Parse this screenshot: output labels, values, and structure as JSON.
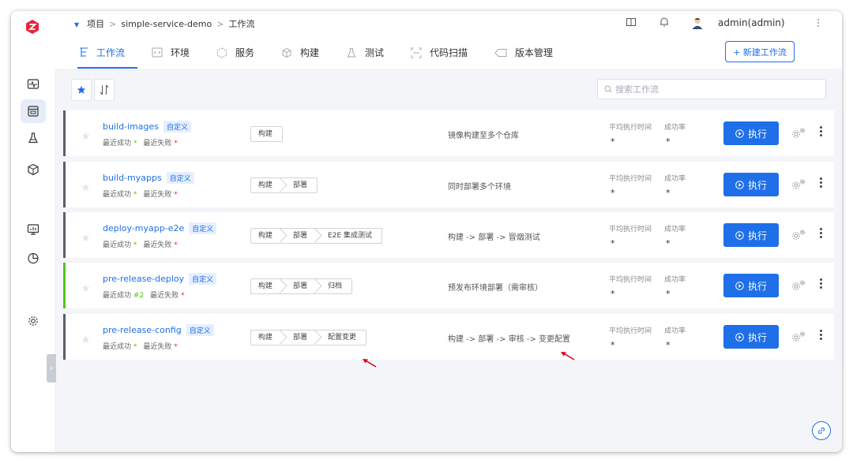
{
  "colors": {
    "accent": "#1e6fe8",
    "success": "#52c41a",
    "danger": "#f5222d"
  },
  "breadcrumb": {
    "root": "项目",
    "project": "simple-service-demo",
    "current": "工作流",
    "sep": ">"
  },
  "user": {
    "name": "admin(admin)"
  },
  "rail_icons": [
    "monitor-pulse-icon",
    "workflow-icon",
    "flask-icon",
    "package-icon",
    "dashboard-icon",
    "pie-chart-icon",
    "gear-icon"
  ],
  "tabs": [
    {
      "label": "工作流",
      "icon": "workflow-icon",
      "active": true
    },
    {
      "label": "环境",
      "icon": "code-icon"
    },
    {
      "label": "服务",
      "icon": "hexagon-icon"
    },
    {
      "label": "构建",
      "icon": "box-icon"
    },
    {
      "label": "测试",
      "icon": "flask-icon"
    },
    {
      "label": "代码扫描",
      "icon": "scan-icon"
    },
    {
      "label": "版本管理",
      "icon": "tag-icon"
    }
  ],
  "new_button": "+ 新建工作流",
  "search": {
    "placeholder": "搜索工作流"
  },
  "stat_labels": {
    "avg_time": "平均执行时间",
    "success_rate": "成功率"
  },
  "run_label": "执行",
  "workflows": [
    {
      "name": "build-images",
      "badge": "自定义",
      "recent_ok": "最近成功",
      "ok_val": "*",
      "recent_fail": "最近失败",
      "fail_val": "*",
      "stages": [
        "构建"
      ],
      "desc": "镜像构建至多个仓库",
      "avg": "*",
      "rate": "*",
      "status": "default"
    },
    {
      "name": "build-myapps",
      "badge": "自定义",
      "recent_ok": "最近成功",
      "ok_val": "*",
      "recent_fail": "最近失败",
      "fail_val": "*",
      "stages": [
        "构建",
        "部署"
      ],
      "desc": "同时部署多个环境",
      "avg": "*",
      "rate": "*",
      "status": "default"
    },
    {
      "name": "deploy-myapp-e2e",
      "badge": "自定义",
      "recent_ok": "最近成功",
      "ok_val": "*",
      "recent_fail": "最近失败",
      "fail_val": "*",
      "stages": [
        "构建",
        "部署",
        "E2E 集成测试"
      ],
      "desc": "构建 -> 部署 -> 冒烟测试",
      "avg": "*",
      "rate": "*",
      "status": "default"
    },
    {
      "name": "pre-release-deploy",
      "badge": "自定义",
      "recent_ok": "最近成功",
      "ok_val": "#2",
      "recent_fail": "最近失败",
      "fail_val": "*",
      "stages": [
        "构建",
        "部署",
        "归档"
      ],
      "desc": "预发布环境部署（需审核）",
      "avg": "*",
      "rate": "*",
      "status": "success"
    },
    {
      "name": "pre-release-config",
      "badge": "自定义",
      "recent_ok": "最近成功",
      "ok_val": "*",
      "recent_fail": "最近失败",
      "fail_val": "*",
      "stages": [
        "构建",
        "部署",
        "配置变更"
      ],
      "desc": "构建 -> 部署 -> 审核 -> 变更配置",
      "avg": "*",
      "rate": "*",
      "status": "default"
    }
  ]
}
